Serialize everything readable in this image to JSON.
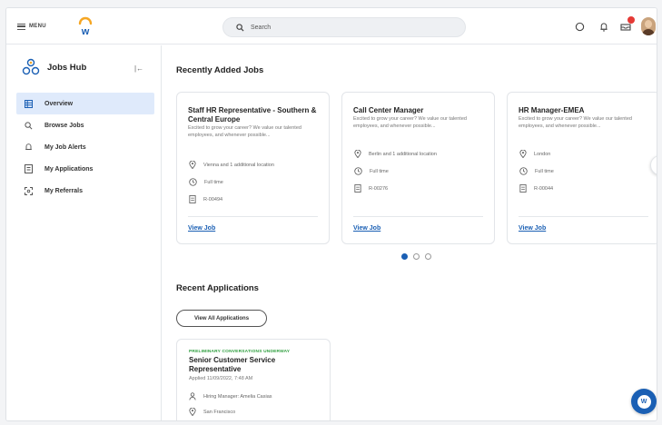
{
  "topbar": {
    "menu_label": "MENU",
    "search_placeholder": "Search",
    "icons": [
      "chat-icon",
      "bell-icon",
      "inbox-icon"
    ],
    "inbox_badge_color": "#e53935"
  },
  "sidebar": {
    "title": "Jobs Hub",
    "collapse_icon": "|←",
    "items": [
      {
        "label": "Overview",
        "icon": "grid-icon",
        "active": true
      },
      {
        "label": "Browse Jobs",
        "icon": "search-icon"
      },
      {
        "label": "My Job Alerts",
        "icon": "bell-icon"
      },
      {
        "label": "My Applications",
        "icon": "document-icon"
      },
      {
        "label": "My Referrals",
        "icon": "referral-icon"
      }
    ]
  },
  "recent_jobs": {
    "title": "Recently Added Jobs",
    "cards": [
      {
        "title": "Staff HR Representative - Southern & Central Europe",
        "desc": "Excited to grow your career? We value our talented employees, and whenever possible...",
        "location": "Vienna and 1 additional location",
        "time": "Full time",
        "req": "R-00494",
        "link": "View Job"
      },
      {
        "title": "Call Center Manager",
        "desc": "Excited to grow your career? We value our talented employees, and whenever possible...",
        "location": "Berlin and 1 additional location",
        "time": "Full time",
        "req": "R-00276",
        "link": "View Job"
      },
      {
        "title": "HR Manager-EMEA",
        "desc": "Excited to grow your career? We value our talented employees, and whenever possible...",
        "location": "London",
        "time": "Full time",
        "req": "R-00044",
        "link": "View Job"
      }
    ],
    "pages": 3,
    "current_page": 1
  },
  "recent_applications": {
    "title": "Recent Applications",
    "view_all_label": "View All Applications",
    "card": {
      "status": "PRELIMINARY CONVERSATIONS UNDERWAY",
      "title": "Senior Customer Service Representative",
      "applied": "Applied 11/09/2022, 7:48 AM",
      "hiring_manager": "Hiring Manager: Amelia Casias",
      "location": "San Francisco"
    }
  },
  "fab": {
    "label": "W"
  },
  "colors": {
    "accent": "#1a5fb4",
    "active_bg": "#dfeafb",
    "status_green": "#2e9e3e"
  }
}
